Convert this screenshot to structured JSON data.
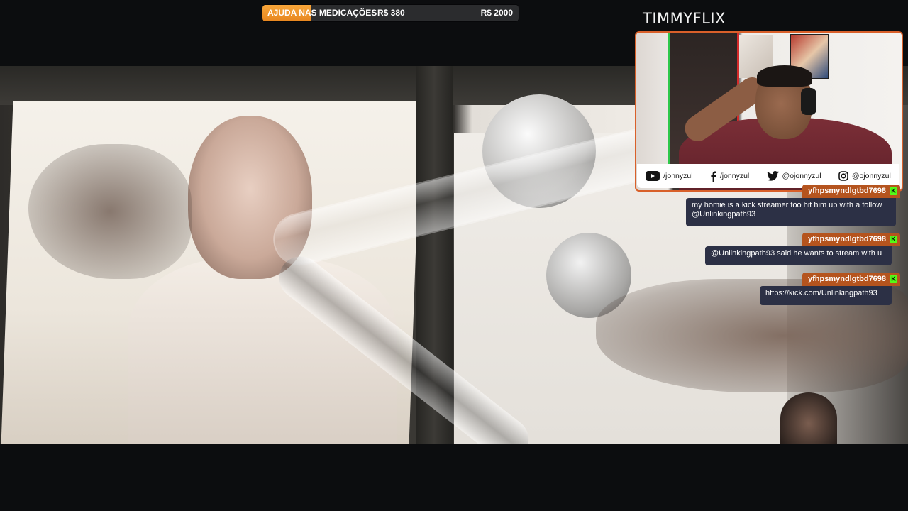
{
  "goal": {
    "label": "AJUDA NAS MEDICAÇÕES",
    "current": "R$ 380",
    "target": "R$ 2000",
    "progress_fraction": 0.19,
    "fill_color": "#f29a2f"
  },
  "streamer": {
    "name": "TIMMYFLIX"
  },
  "socials": [
    {
      "icon": "youtube-icon",
      "handle": "/jonnyzul"
    },
    {
      "icon": "facebook-icon",
      "handle": "/jonnyzul"
    },
    {
      "icon": "twitter-icon",
      "handle": "@ojonnyzul"
    },
    {
      "icon": "instagram-icon",
      "handle": "@ojonnyzul"
    }
  ],
  "chat": [
    {
      "username": "yfhpsmyndlgtbd7698",
      "lines": [
        "my homie is a kick streamer too hit him up with a follow",
        "@Unlinkingpath93"
      ]
    },
    {
      "username": "yfhpsmyndlgtbd7698",
      "lines": [
        "@Unlinkingpath93 said he wants to stream with u"
      ]
    },
    {
      "username": "yfhpsmyndlgtbd7698",
      "lines": [
        "https://kick.com/Unlinkingpath93"
      ]
    }
  ],
  "colors": {
    "chat_user_bg": "#b5541e",
    "chat_bubble_bg": "#2c3045",
    "kick_badge": "#53fc18",
    "cam_border": "#d9602a"
  }
}
